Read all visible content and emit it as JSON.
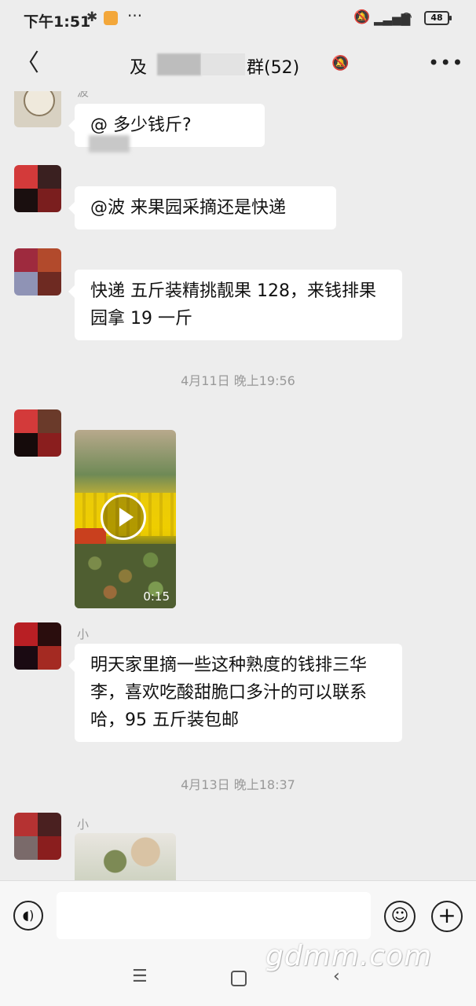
{
  "status_bar": {
    "time": "下午1:51",
    "battery": "48"
  },
  "header": {
    "title_left": "及",
    "title_right": "群(52)"
  },
  "messages": [
    {
      "name": "波",
      "text": "@   多少钱斤?"
    },
    {
      "name": "",
      "text": "@波  来果园采摘还是快递"
    },
    {
      "name": "",
      "text": "快递 五斤装精挑靓果 128，来钱排果园拿 19 一斤"
    },
    {
      "name": "",
      "video_duration": "0:15"
    },
    {
      "name": "小",
      "text": "明天家里摘一些这种熟度的钱排三华李，喜欢吃酸甜脆口多汁的可以联系哈，95 五斤装包邮"
    },
    {
      "name": "小"
    }
  ],
  "timestamps": [
    "4月11日 晚上19:56",
    "4月13日 晚上18:37"
  ],
  "watermark": "gdmm.com"
}
